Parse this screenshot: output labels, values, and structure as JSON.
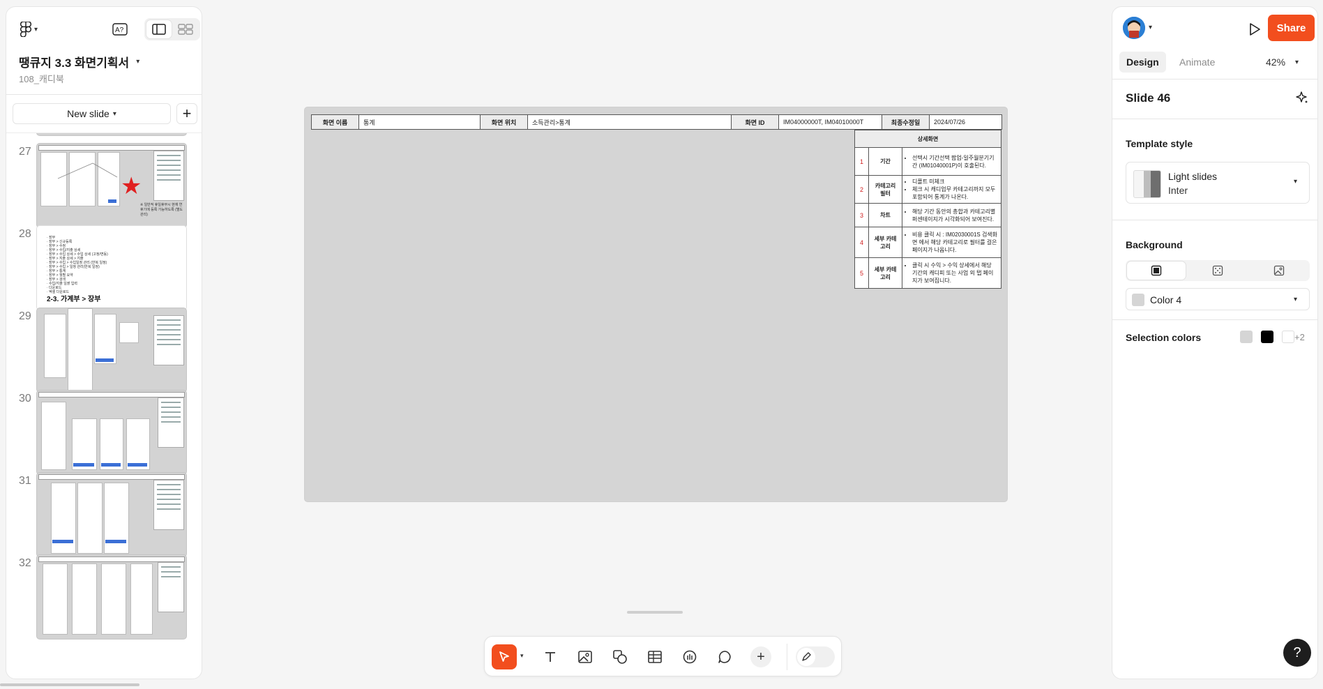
{
  "left_panel": {
    "file_title": "땡큐지 3.3 화면기획서",
    "file_subtitle": "108_캐디북",
    "new_slide_label": "New slide",
    "add_slide_label": "+",
    "slides": [
      {
        "number": "27",
        "caption": "※ 일반적 휴일휴무시 현재 연휴기에 등록 가능하도록 (별도 관리)"
      },
      {
        "number": "28",
        "title": "2-3. 가계부 > 장부"
      },
      {
        "number": "29"
      },
      {
        "number": "30"
      },
      {
        "number": "31"
      },
      {
        "number": "32"
      }
    ],
    "thumb28_lines": [
      "· 장부",
      "· 장부 > 신규등록",
      "· 장부 > 수정",
      "· 장부 > 수입/지출 상세",
      "· 장부 > 수입 상세 > 수입 상세 (고정/변동)",
      "· 장부 > 지출 상세 > 지출",
      "· 장부 > 수입 > 수입일정 관리 (반복 일정)",
      "· 장부 > 수입 > 일정 관리(반복 일정)",
      "· 장부 > 통계",
      "· 장부 > 월별 요약",
      "· 장부 > 검색",
      "· 수입/지출 일괄 입력",
      "· 다운로드",
      "· 엑셀 다운로드"
    ]
  },
  "slide": {
    "header": {
      "screen_name_label": "화면 이름",
      "screen_name_value": "통계",
      "screen_location_label": "화면 위치",
      "screen_location_value": "소득관리>통계",
      "screen_id_label": "화면 ID",
      "screen_id_value": "IM04000000T, IM04010000T",
      "last_modified_label": "최종수정일",
      "last_modified_value": "2024/07/26"
    },
    "detail_title": "상세화면",
    "details": [
      {
        "num": "1",
        "name": "기간",
        "items": [
          "선택시 기간선택 팝업-일주월분기기간 (IM01040001P)이 호출된다."
        ]
      },
      {
        "num": "2",
        "name": "카테고리 필터",
        "items": [
          "디폴트 미체크",
          "체크 시 캐디업무 카테고리까지 모두 포함되어 통계가 나온다."
        ]
      },
      {
        "num": "3",
        "name": "차트",
        "items": [
          "해당 기간 동안의 총합과 카테고리별 퍼센테이지가 시각화되어 보여진다."
        ]
      },
      {
        "num": "4",
        "name": "세부 카테고리",
        "items": [
          "비용 클릭 시 : IM02030001S 검색화면 에서 해당 카테고리로 필터를 걸은 페이지가 나옵니다."
        ]
      },
      {
        "num": "5",
        "name": "세부 카테고리",
        "items": [
          "클릭 시 수익 > 수익 상세에서 해당 기간의 캐디피 또는 사업 외 탭 페이지가 보여집니다."
        ]
      }
    ]
  },
  "right_panel": {
    "share_label": "Share",
    "tabs": {
      "design": "Design",
      "animate": "Animate"
    },
    "zoom": "42%",
    "slide_name": "Slide 46",
    "template_style_label": "Template style",
    "template_name": "Light slides",
    "template_font": "Inter",
    "background_label": "Background",
    "background_color": "Color 4",
    "selection_colors_label": "Selection colors",
    "selection_colors": [
      "#d5d5d5",
      "#000000",
      "#ffffff"
    ],
    "selection_more": "+2"
  },
  "toolbar": {
    "tools": [
      "cursor-tool",
      "text-tool",
      "image-tool",
      "shape-tool",
      "table-tool",
      "stamp-tool",
      "comment-tool",
      "more-tools"
    ]
  },
  "help": "?",
  "colors": {
    "accent": "#f24e1e",
    "canvas_bg": "#d5d5d5",
    "marker_red": "#d01f1f"
  }
}
